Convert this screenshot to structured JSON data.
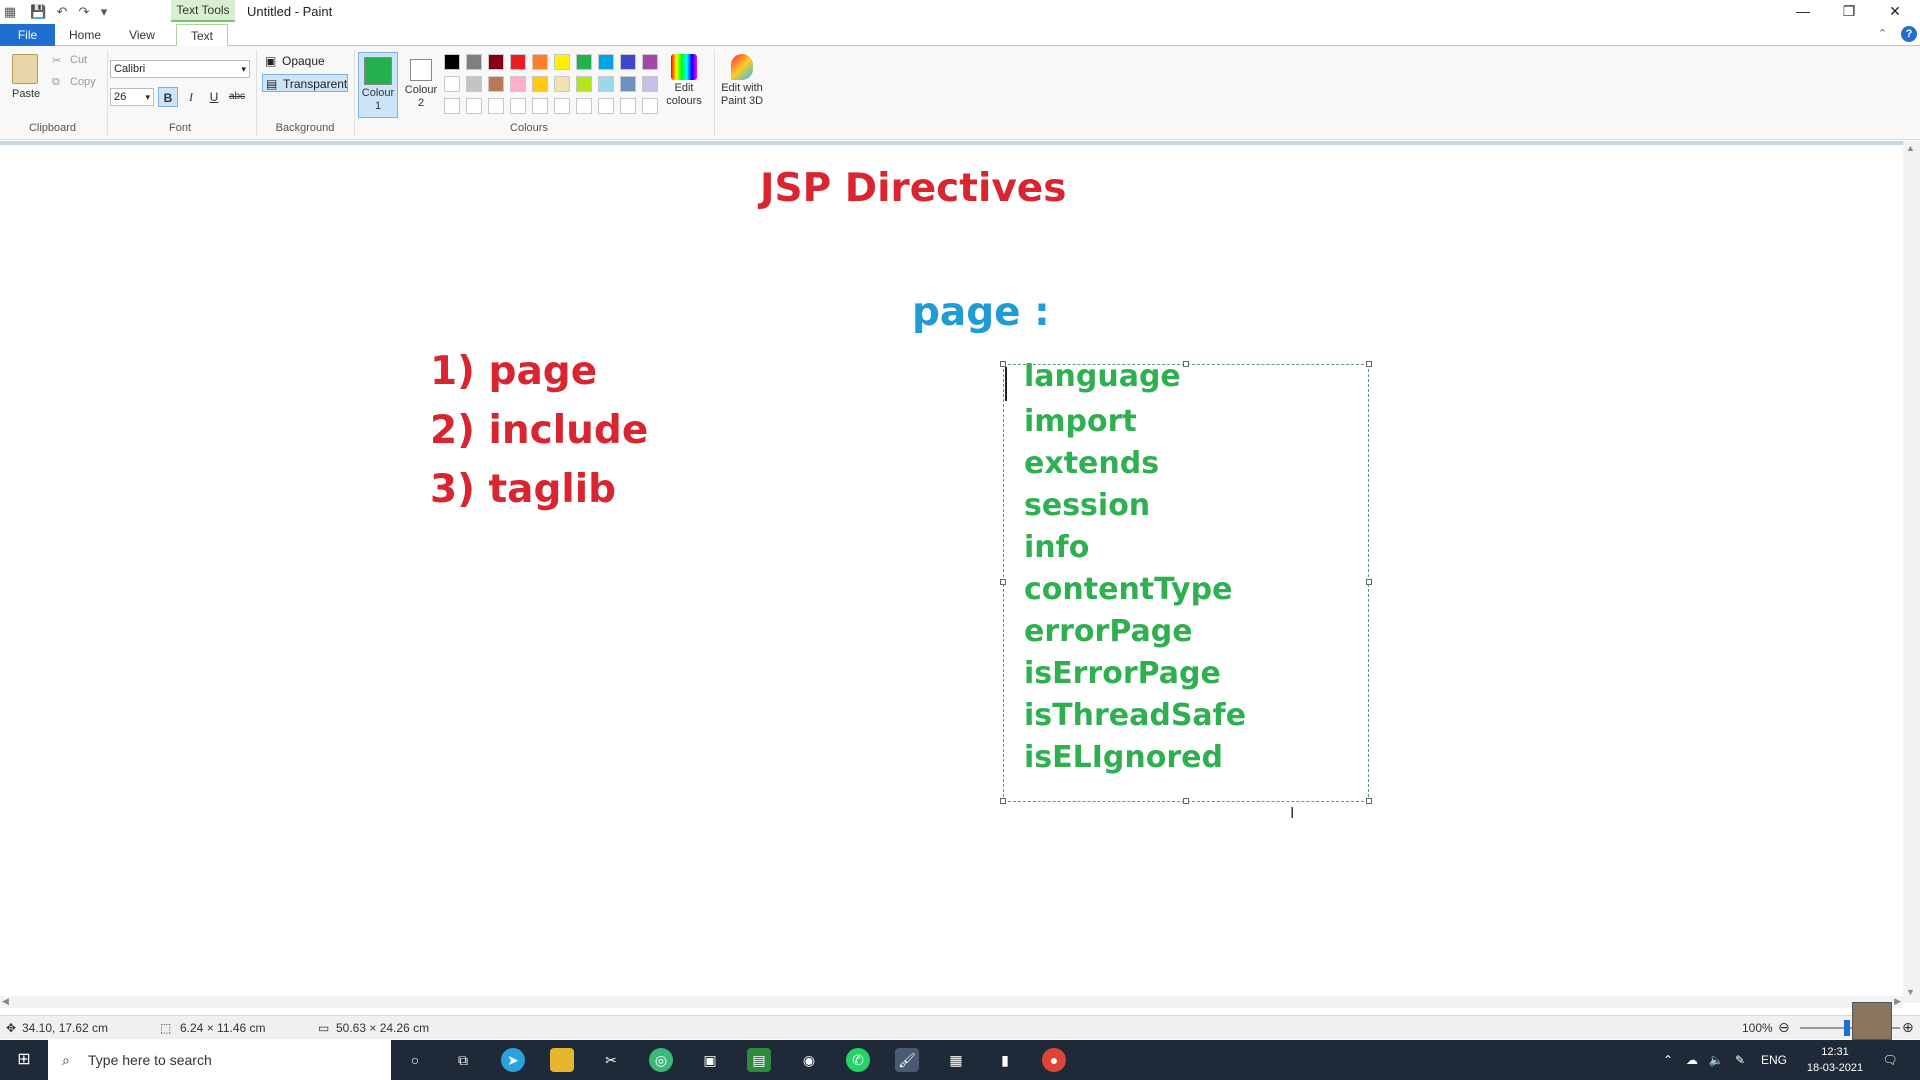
{
  "window": {
    "context_tab": "Text Tools",
    "title": "Untitled - Paint"
  },
  "tabs": [
    "File",
    "Home",
    "View",
    "Text"
  ],
  "ribbon": {
    "clipboard": {
      "paste": "Paste",
      "cut": "Cut",
      "copy": "Copy",
      "label": "Clipboard"
    },
    "font": {
      "family": "Calibri",
      "size": "26",
      "bold": "B",
      "italic": "I",
      "underline": "U",
      "strike": "abc",
      "label": "Font"
    },
    "background": {
      "opaque": "Opaque",
      "transparent": "Transparent",
      "label": "Background"
    },
    "colours": {
      "colour1_label": "Colour 1",
      "colour2_label": "Colour 2",
      "colour1": "#22b14c",
      "colour2": "#ffffff",
      "edit_label": "Edit colours",
      "paint3d_label": "Edit with Paint 3D",
      "label": "Colours",
      "row1": [
        "#000000",
        "#7f7f7f",
        "#880015",
        "#ed1c24",
        "#ff7f27",
        "#fff200",
        "#22b14c",
        "#00a2e8",
        "#3f48cc",
        "#a349a4"
      ],
      "row2": [
        "#ffffff",
        "#c3c3c3",
        "#b97a57",
        "#ffaec9",
        "#ffc90e",
        "#efe4b0",
        "#b5e61d",
        "#99d9ea",
        "#7092be",
        "#c8bfe7"
      ],
      "row3": [
        "#ffffff",
        "#ffffff",
        "#ffffff",
        "#ffffff",
        "#ffffff",
        "#ffffff",
        "#ffffff",
        "#ffffff",
        "#ffffff",
        "#ffffff"
      ]
    }
  },
  "canvas": {
    "title": "JSP Directives",
    "subtitle": "page :",
    "directives": [
      "1) page",
      "2) include",
      "3) taglib"
    ],
    "attributes": [
      "language",
      "import",
      "extends",
      "session",
      "info",
      "contentType",
      "errorPage",
      "isErrorPage",
      "isThreadSafe",
      "isELIgnored"
    ],
    "colors": {
      "title": "#d9252f",
      "subtitle": "#1f9bd6",
      "attributes": "#2fb050"
    }
  },
  "status": {
    "cursor": "34.10, 17.62 cm",
    "selection": "6.24 × 11.46 cm",
    "canvas_size": "50.63 × 24.26 cm",
    "zoom": "100%"
  },
  "taskbar": {
    "search_placeholder": "Type here to search",
    "lang": "ENG",
    "time": "12:31",
    "date": "18-03-2021"
  }
}
